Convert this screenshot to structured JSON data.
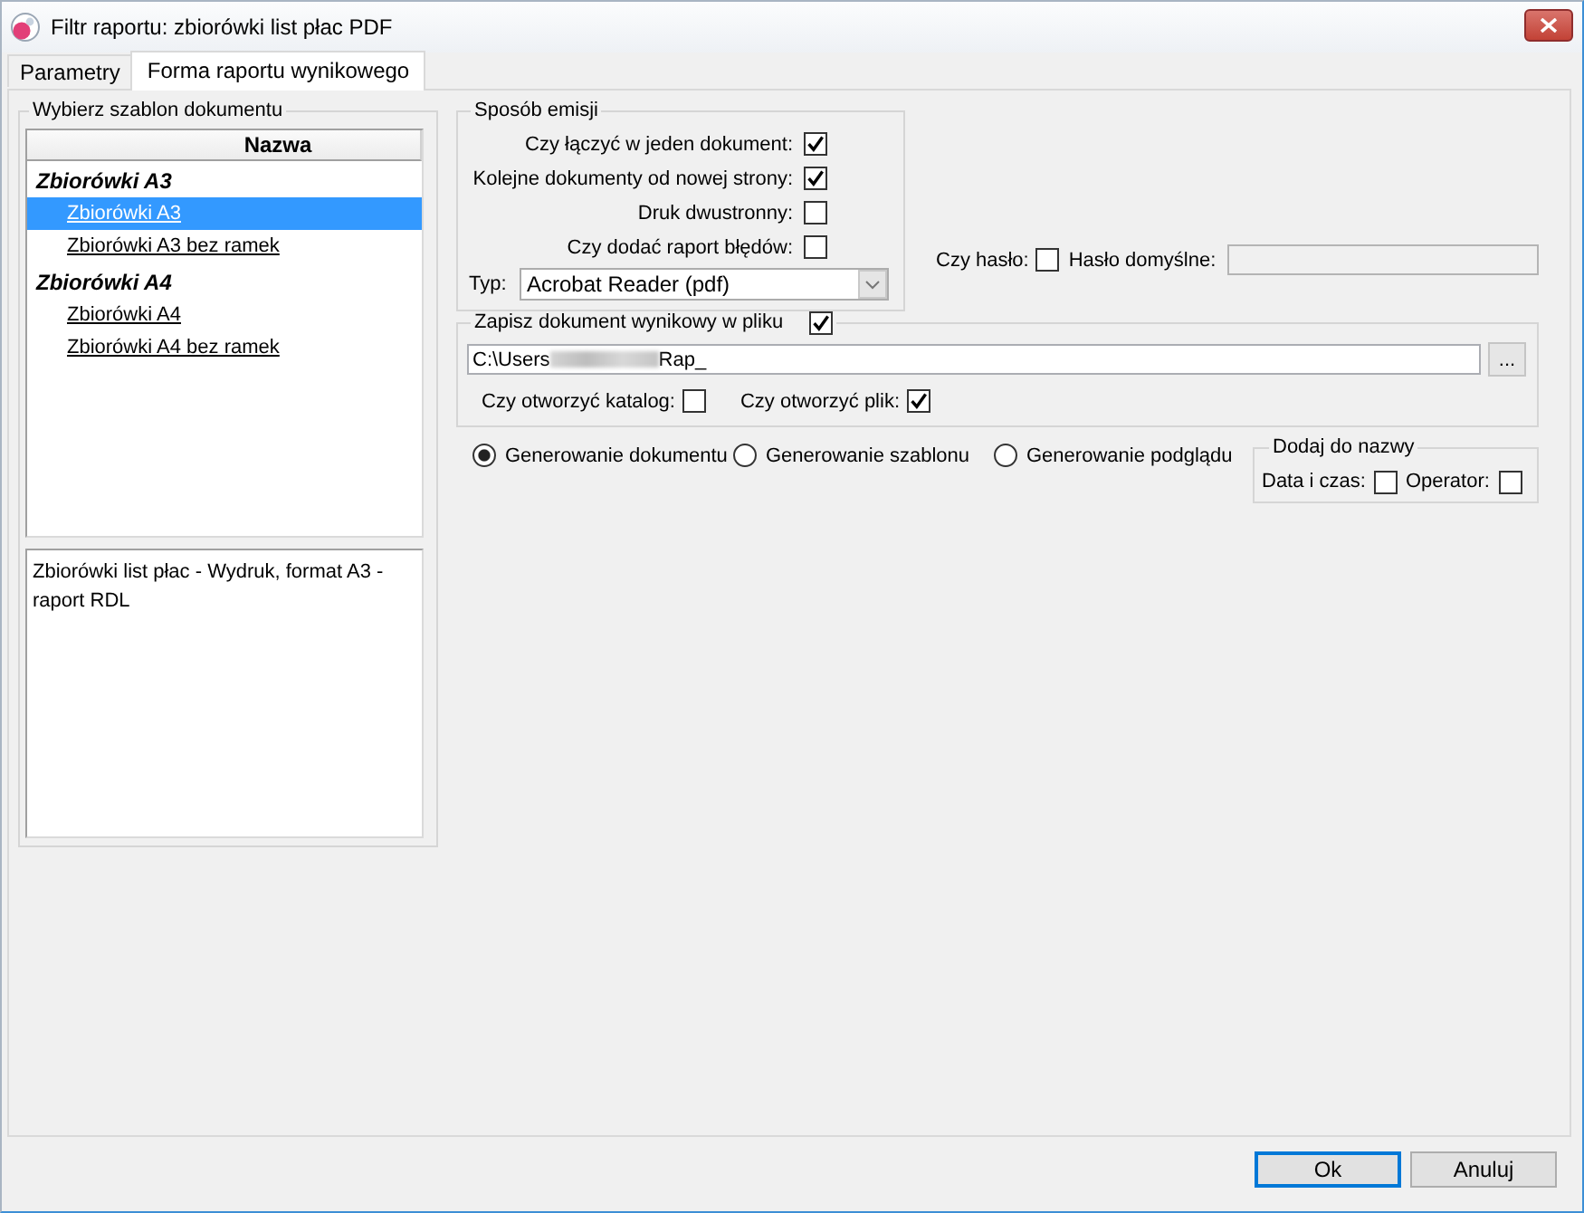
{
  "window": {
    "title": "Filtr raportu: zbiorówki list płac PDF"
  },
  "tabs": [
    {
      "label": "Parametry",
      "selected": false
    },
    {
      "label": "Forma raportu wynikowego",
      "selected": true
    }
  ],
  "template_group": {
    "title": "Wybierz szablon dokumentu",
    "column": "Nazwa",
    "items": [
      {
        "label": "Zbiorówki A3",
        "selected": false,
        "children": [
          {
            "label": "Zbiorówki A3",
            "selected": true
          },
          {
            "label": "Zbiorówki A3 bez ramek",
            "selected": false
          }
        ]
      },
      {
        "label": "Zbiorówki A4",
        "selected": false,
        "children": [
          {
            "label": "Zbiorówki A4",
            "selected": false
          },
          {
            "label": "Zbiorówki A4 bez ramek",
            "selected": false
          }
        ]
      }
    ],
    "description": "Zbiorówki list płac - Wydruk, format A3 - raport RDL"
  },
  "emission": {
    "title": "Sposób emisji",
    "options": [
      {
        "label": "Czy łączyć w jeden dokument:",
        "checked": true
      },
      {
        "label": "Kolejne dokumenty od nowej strony:",
        "checked": true
      },
      {
        "label": "Druk dwustronny:",
        "checked": false
      },
      {
        "label": "Czy dodać raport błędów:",
        "checked": false
      }
    ],
    "type": {
      "label": "Typ:",
      "value": "Acrobat Reader (pdf)"
    }
  },
  "password": {
    "label": "Czy hasło:",
    "checked": false,
    "default_label": "Hasło domyślne:",
    "field_disabled": true
  },
  "save_to_file": {
    "label": "Zapisz dokument wynikowy w pliku",
    "checked": true,
    "path": {
      "value_start": "C:\\Users",
      "blurred": true,
      "value_end": "Rap_"
    },
    "browse_button": "...",
    "options": [
      {
        "label": "Czy otworzyć katalog:",
        "checked": false
      },
      {
        "label": "Czy otworzyć plik:",
        "checked": true
      }
    ]
  },
  "generation_modes": [
    {
      "label": "Generowanie dokumentu",
      "selected": true
    },
    {
      "label": "Generowanie szablonu",
      "selected": false
    },
    {
      "label": "Generowanie podglądu",
      "selected": false
    }
  ],
  "add_to_name": {
    "title": "Dodaj do nazwy",
    "options": [
      {
        "label": "Data i czas:",
        "checked": false
      },
      {
        "label": "Operator:",
        "checked": false
      }
    ]
  },
  "buttons": [
    {
      "label": "Ok",
      "focused": true
    },
    {
      "label": "Anuluj",
      "focused": false
    }
  ]
}
